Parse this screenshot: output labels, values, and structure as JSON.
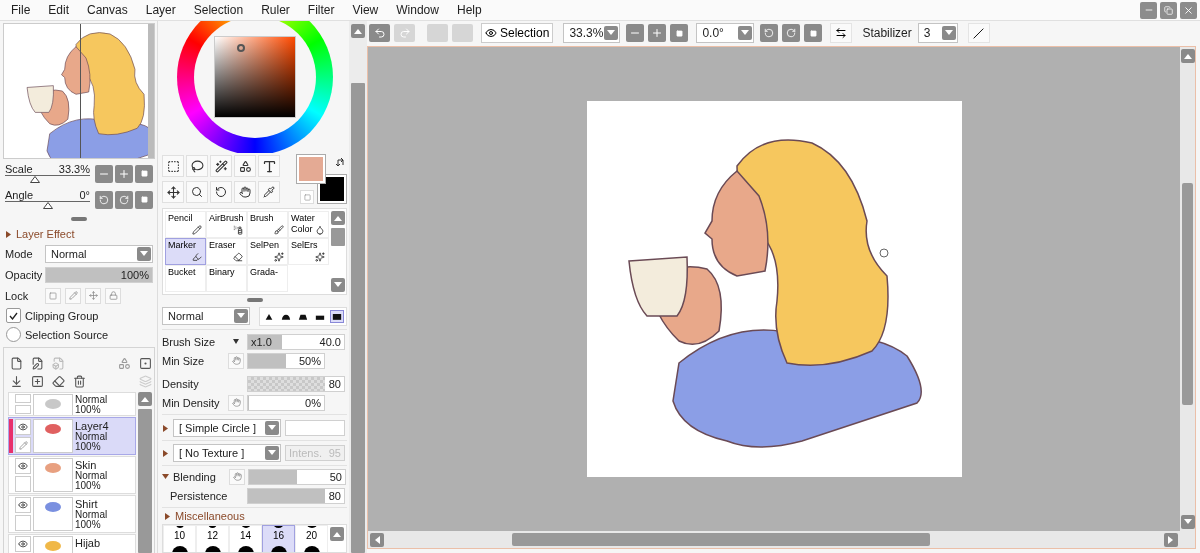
{
  "menu": [
    "File",
    "Edit",
    "Canvas",
    "Layer",
    "Selection",
    "Ruler",
    "Filter",
    "View",
    "Window",
    "Help"
  ],
  "toolbar": {
    "history": [
      {
        "kind": "undo",
        "disabled": false
      },
      {
        "kind": "redo",
        "disabled": true
      },
      {
        "kind": "blank",
        "disabled": true
      },
      {
        "kind": "blank",
        "disabled": true
      }
    ],
    "view_toggle": {
      "label": "Selection",
      "on": true
    },
    "zoom": "33.3%",
    "angle": "0.0°",
    "stabilizer": {
      "label": "Stabilizer",
      "value": "3"
    }
  },
  "navigator": {
    "sliders": [
      {
        "kind": "scale",
        "label": "Scale",
        "value": "33.3%",
        "level": 0.35
      },
      {
        "kind": "angle",
        "label": "Angle",
        "value": "0°",
        "level": 0.5
      }
    ]
  },
  "layer_panel": {
    "effect": {
      "label": "Layer Effect",
      "expanded": false
    },
    "mode": {
      "label": "Mode",
      "value": "Normal"
    },
    "opacity": {
      "label": "Opacity",
      "value": "100%",
      "level": 1
    },
    "lock": {
      "label": "Lock"
    },
    "options": [
      {
        "kind": "checkbox",
        "label": "Clipping Group",
        "checked": true
      },
      {
        "kind": "radio",
        "label": "Selection Source",
        "checked": false
      }
    ],
    "layers": [
      {
        "mode": "Normal",
        "opacity": "100%",
        "visible": false,
        "editing": false,
        "selected": false,
        "color": "#c8c8c8"
      },
      {
        "name": "Layer4",
        "mode": "Normal",
        "opacity": "100%",
        "visible": true,
        "editing": true,
        "selected": true,
        "color": "#e06060"
      },
      {
        "name": "Skin",
        "mode": "Normal",
        "opacity": "100%",
        "visible": true,
        "editing": false,
        "selected": false,
        "color": "#e8a080"
      },
      {
        "name": "Shirt",
        "mode": "Normal",
        "opacity": "100%",
        "visible": true,
        "editing": false,
        "selected": false,
        "color": "#7a90e0"
      },
      {
        "name": "Hijab",
        "visible": true,
        "selected": false,
        "color": "#f0b848"
      }
    ]
  },
  "swatches": [
    {
      "kind": "foreground",
      "color": "#e4aa94"
    },
    {
      "kind": "background",
      "color": "#000000"
    }
  ],
  "brushes": [
    {
      "label": "Pencil",
      "kind": "pencil",
      "selected": false
    },
    {
      "label": "AirBrush",
      "kind": "airbrush",
      "selected": false
    },
    {
      "label": "Brush",
      "kind": "brush",
      "selected": false
    },
    {
      "label": "Water Color",
      "kind": "water",
      "selected": false
    },
    {
      "label": "Marker",
      "kind": "marker",
      "selected": true
    },
    {
      "label": "Eraser",
      "kind": "eraser",
      "selected": false
    },
    {
      "label": "SelPen",
      "kind": "selpen",
      "selected": false
    },
    {
      "label": "SelErs",
      "kind": "selers",
      "selected": false
    },
    {
      "label": "Bucket",
      "kind": "bucket",
      "selected": false
    },
    {
      "label": "Binary",
      "kind": "binary",
      "selected": false
    },
    {
      "label": "Grada-",
      "kind": "gradation",
      "selected": false
    }
  ],
  "brush": {
    "mode": "Normal",
    "shapes": [
      {
        "kind": "cone",
        "selected": false
      },
      {
        "kind": "dome",
        "selected": false
      },
      {
        "kind": "flat",
        "selected": false
      },
      {
        "kind": "bar",
        "selected": false
      },
      {
        "kind": "block",
        "selected": true
      }
    ],
    "params": [
      {
        "kind": "size",
        "label": "Brush Size",
        "multiplier": "x1.0",
        "value": "40.0",
        "level": 0.35
      },
      {
        "kind": "pressure",
        "label": "Min Size",
        "value": "50%",
        "level": 0.5
      },
      {
        "kind": "density",
        "label": "Density",
        "value": "80",
        "level": 0.8
      },
      {
        "kind": "pressure",
        "label": "Min Density",
        "value": "0%",
        "level": 0
      }
    ],
    "shape": {
      "value": "[ Simple Circle ]",
      "expanded": false
    },
    "texture": {
      "value": "[ No Texture ]",
      "expanded": false,
      "intensity_label": "Intens.",
      "intensity": "95",
      "disabled": true
    },
    "blending": {
      "label": "Blending",
      "expanded": true,
      "value": "50",
      "level": 0.5
    },
    "persistence": {
      "label": "Persistence",
      "value": "80",
      "level": 0.8
    },
    "misc": {
      "label": "Miscellaneous",
      "expanded": false
    },
    "sizes": [
      {
        "label": "10",
        "selected": false
      },
      {
        "label": "12",
        "selected": false
      },
      {
        "label": "14",
        "selected": false
      },
      {
        "label": "16",
        "selected": true
      },
      {
        "label": "20",
        "selected": false
      }
    ]
  }
}
